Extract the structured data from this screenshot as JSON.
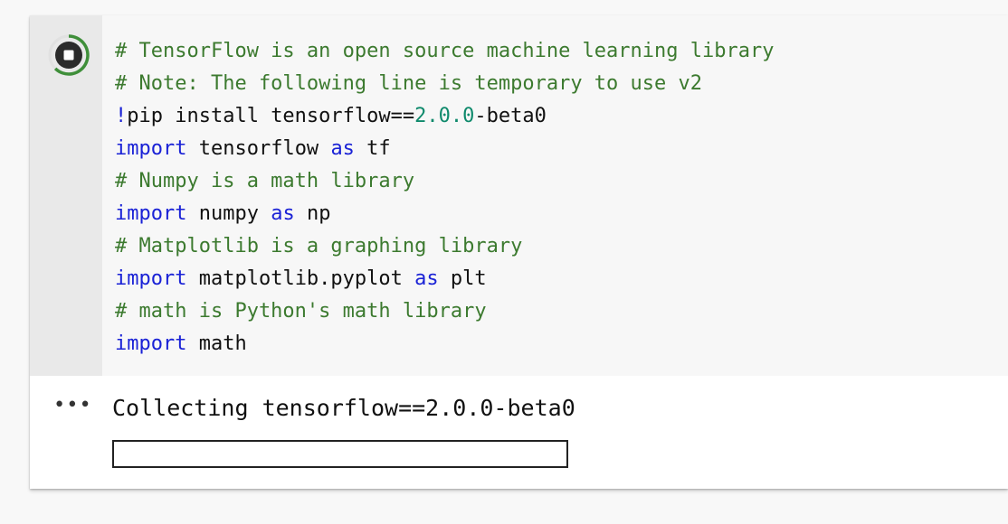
{
  "cell": {
    "run_button_icon": "stop-icon",
    "code_lines": [
      [
        {
          "t": "comment",
          "v": "# TensorFlow is an open source machine learning library"
        }
      ],
      [
        {
          "t": "comment",
          "v": "# Note: The following line is temporary to use v2"
        }
      ],
      [
        {
          "t": "keyword",
          "v": "!"
        },
        {
          "t": "plain",
          "v": "pip install tensorflow=="
        },
        {
          "t": "number",
          "v": "2.0.0"
        },
        {
          "t": "plain",
          "v": "-beta0"
        }
      ],
      [
        {
          "t": "keyword",
          "v": "import"
        },
        {
          "t": "plain",
          "v": " tensorflow "
        },
        {
          "t": "keyword",
          "v": "as"
        },
        {
          "t": "plain",
          "v": " tf"
        }
      ],
      [
        {
          "t": "comment",
          "v": "# Numpy is a math library"
        }
      ],
      [
        {
          "t": "keyword",
          "v": "import"
        },
        {
          "t": "plain",
          "v": " numpy "
        },
        {
          "t": "keyword",
          "v": "as"
        },
        {
          "t": "plain",
          "v": " np"
        }
      ],
      [
        {
          "t": "comment",
          "v": "# Matplotlib is a graphing library"
        }
      ],
      [
        {
          "t": "keyword",
          "v": "import"
        },
        {
          "t": "plain",
          "v": " matplotlib.pyplot "
        },
        {
          "t": "keyword",
          "v": "as"
        },
        {
          "t": "plain",
          "v": " plt"
        }
      ],
      [
        {
          "t": "comment",
          "v": "# math is Python's math library"
        }
      ],
      [
        {
          "t": "keyword",
          "v": "import"
        },
        {
          "t": "plain",
          "v": " math"
        }
      ]
    ]
  },
  "output": {
    "ellipsis": "•••",
    "text": "Collecting tensorflow==2.0.0-beta0",
    "progress_fraction": 0
  },
  "colors": {
    "comment": "#3c7a2f",
    "keyword": "#1a22d6",
    "number": "#0f8a6c",
    "plain": "#111111",
    "run_button_dark": "#2b2b2b",
    "run_button_green": "#3f8f3a"
  }
}
